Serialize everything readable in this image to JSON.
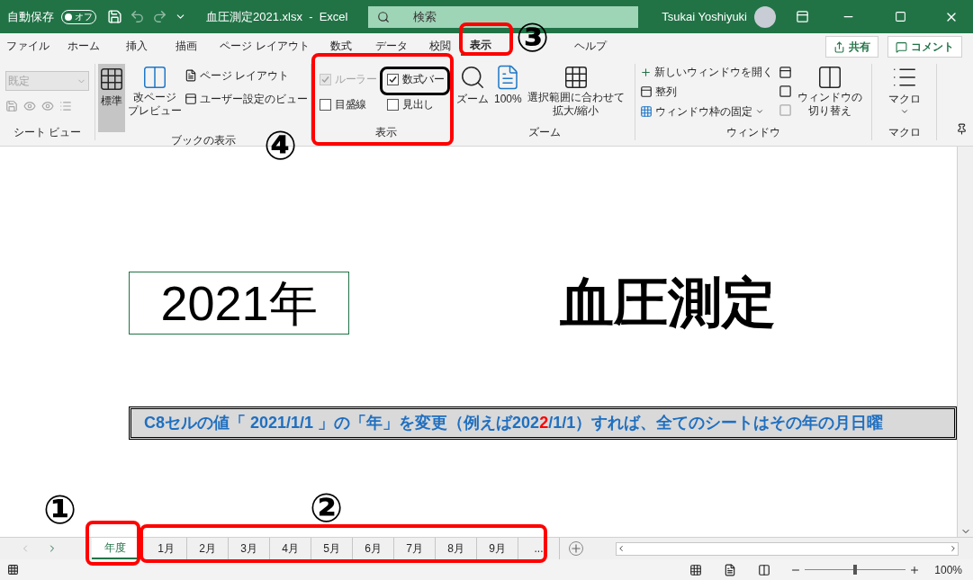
{
  "title_bar": {
    "autosave_label": "自動保存",
    "autosave": {
      "label": "オフ",
      "on": false
    },
    "title": "血圧測定2021.xlsx  -  Excel",
    "search": {
      "placeholder": "検索"
    },
    "user": "Tsukai Yoshiyuki"
  },
  "tabs": [
    {
      "label": "ファイル",
      "selected": false
    },
    {
      "label": "ホーム",
      "selected": false
    },
    {
      "label": "挿入",
      "selected": false
    },
    {
      "label": "描画",
      "selected": false
    },
    {
      "label": "ページ レイアウト",
      "selected": false
    },
    {
      "label": "数式",
      "selected": false
    },
    {
      "label": "データ",
      "selected": false
    },
    {
      "label": "校閲",
      "selected": false
    },
    {
      "label": "表示",
      "selected": true
    },
    {
      "label": "ヘルプ",
      "selected": false
    }
  ],
  "share_button": "共有",
  "comment_button": "コメント",
  "ribbon": {
    "sheet_view": {
      "dropdown": "既定",
      "label": "シート ビュー"
    },
    "workbook_views": {
      "label": "ブックの表示",
      "normal": {
        "label": "標準",
        "selected": true
      },
      "page_break": [
        "改ページ",
        "プレビュー"
      ],
      "page_layout": "ページ レイアウト",
      "custom": "ユーザー設定のビュー"
    },
    "show": {
      "label": "表示",
      "options": [
        {
          "label": "ルーラー",
          "checked": true,
          "disabled": true
        },
        {
          "label": "数式バー",
          "checked": true,
          "disabled": false
        },
        {
          "label": "目盛線",
          "checked": false,
          "disabled": false
        },
        {
          "label": "見出し",
          "checked": false,
          "disabled": false
        }
      ]
    },
    "zoom": {
      "label": "ズーム",
      "zoom_button": "ズーム",
      "hundred_button": "100%",
      "selection_button": [
        "選択範囲に合わせて",
        "拡大/縮小"
      ]
    },
    "window": {
      "label": "ウィンドウ",
      "new_window": "新しいウィンドウを開く",
      "arrange": "整列",
      "freeze": "ウィンドウ枠の固定",
      "switch": [
        "ウィンドウの",
        "切り替え"
      ]
    },
    "macro": {
      "label": "マクロ",
      "button": "マクロ"
    }
  },
  "sheet": {
    "year_cell": "2021年",
    "heading": "血圧測定",
    "banner": [
      {
        "text": "C8セルの値「 2021/1/1 」の「年」を変更（例えば202",
        "color": "#1f6fc0"
      },
      {
        "text": "2",
        "color": "#ff0000"
      },
      {
        "text": "/1/1）すれば、全てのシートはその年の月日曜",
        "color": "#1f6fc0"
      }
    ]
  },
  "sheet_tabs": [
    {
      "label": "年度",
      "selected": true
    },
    {
      "label": "1月",
      "selected": false
    },
    {
      "label": "2月",
      "selected": false
    },
    {
      "label": "3月",
      "selected": false
    },
    {
      "label": "4月",
      "selected": false
    },
    {
      "label": "5月",
      "selected": false
    },
    {
      "label": "6月",
      "selected": false
    },
    {
      "label": "7月",
      "selected": false
    },
    {
      "label": "8月",
      "selected": false
    },
    {
      "label": "9月",
      "selected": false
    },
    {
      "label": "...",
      "selected": false
    }
  ],
  "status_bar": {
    "zoom": {
      "level": 0.5,
      "reading": "100%"
    }
  },
  "annotations": {
    "numbers": [
      "①",
      "②",
      "③",
      "④"
    ],
    "boxes": [
      {
        "color": "#ff0000"
      },
      {
        "color": "#ff0000"
      },
      {
        "color": "#ff0000"
      },
      {
        "color": "#ff0000"
      },
      {
        "color": "#000000"
      }
    ]
  }
}
